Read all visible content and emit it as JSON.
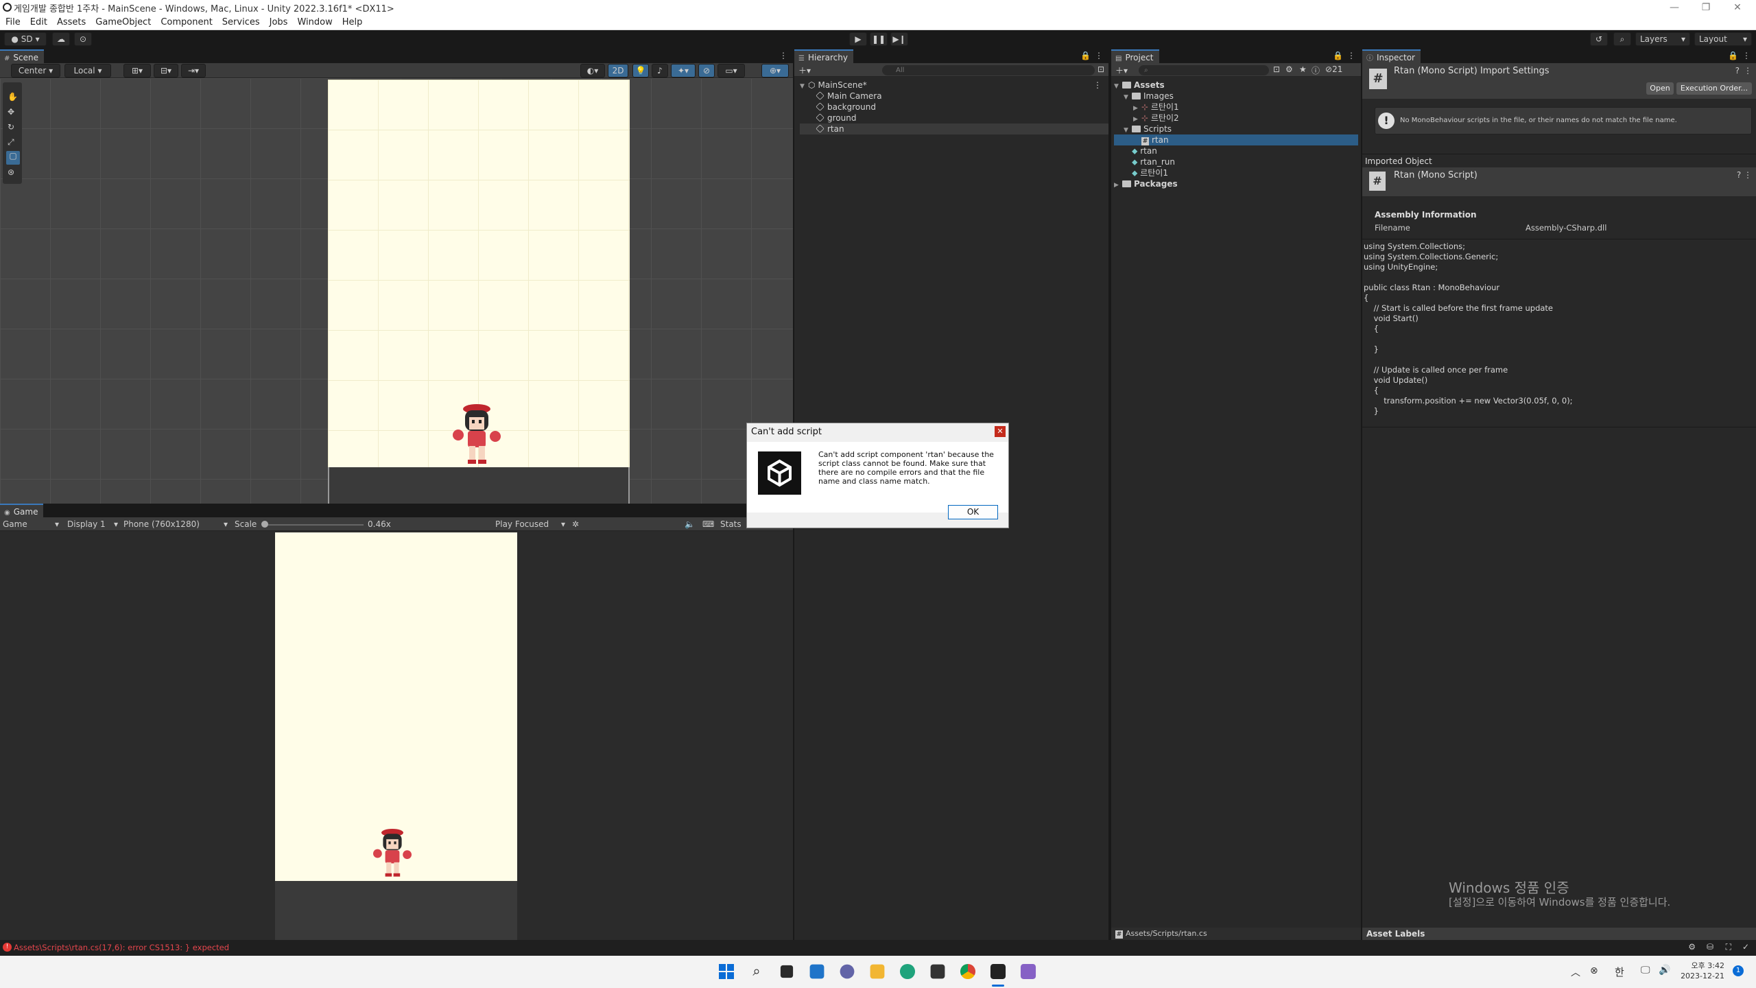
{
  "window": {
    "title": "게임개발 종합반 1주차 - MainScene - Windows, Mac, Linux - Unity 2022.3.16f1* <DX11>"
  },
  "menu": [
    "File",
    "Edit",
    "Assets",
    "GameObject",
    "Component",
    "Services",
    "Jobs",
    "Window",
    "Help"
  ],
  "toolbar": {
    "account": "SD",
    "layers": "Layers",
    "layout": "Layout"
  },
  "scene": {
    "tab": "Scene",
    "pivot": "Center",
    "space": "Local",
    "mode2d": "2D"
  },
  "game": {
    "tab": "Game",
    "view": "Game",
    "display": "Display 1",
    "resolution": "Phone (760x1280)",
    "scale_label": "Scale",
    "scale_value": "0.46x",
    "play_focus": "Play Focused",
    "stats": "Stats"
  },
  "hierarchy": {
    "tab": "Hierarchy",
    "search_placeholder": "All",
    "scene": "MainScene*",
    "items": [
      "Main Camera",
      "background",
      "ground",
      "rtan"
    ]
  },
  "project": {
    "tab": "Project",
    "count": "21",
    "root": "Assets",
    "items": [
      {
        "label": "Images",
        "depth": 1,
        "type": "folder"
      },
      {
        "label": "르탄이1",
        "depth": 2,
        "type": "sprite"
      },
      {
        "label": "르탄이2",
        "depth": 2,
        "type": "sprite"
      },
      {
        "label": "Scripts",
        "depth": 1,
        "type": "folder"
      },
      {
        "label": "rtan",
        "depth": 2,
        "type": "script"
      },
      {
        "label": "rtan",
        "depth": 1,
        "type": "anim"
      },
      {
        "label": "rtan_run",
        "depth": 1,
        "type": "anim"
      },
      {
        "label": "르탄이1",
        "depth": 1,
        "type": "anim"
      }
    ],
    "packages": "Packages",
    "footer_path": "Assets/Scripts/rtan.cs"
  },
  "inspector": {
    "tab": "Inspector",
    "title": "Rtan (Mono Script) Import Settings",
    "open": "Open",
    "execution_order": "Execution Order...",
    "warning": "No MonoBehaviour scripts in the file, or their names do not match the file name.",
    "imported_object": "Imported Object",
    "object_name": "Rtan (Mono Script)",
    "assembly_info": "Assembly Information",
    "filename_label": "Filename",
    "filename_value": "Assembly-CSharp.dll",
    "code": "using System.Collections;\nusing System.Collections.Generic;\nusing UnityEngine;\n\npublic class Rtan : MonoBehaviour\n{\n    // Start is called before the first frame update\n    void Start()\n    {\n\n    }\n\n    // Update is called once per frame\n    void Update()\n    {\n        transform.position += new Vector3(0.05f, 0, 0);\n    }",
    "asset_labels": "Asset Labels",
    "watermark_title": "Windows 정품 인증",
    "watermark_sub": "[설정]으로 이동하여 Windows를 정품 인증합니다."
  },
  "dialog": {
    "title": "Can't add script",
    "message": "Can't add script component 'rtan' because the script class cannot be found. Make sure that there are no compile errors and that the file name and class name match.",
    "ok": "OK"
  },
  "status": {
    "error": "Assets\\Scripts\\rtan.cs(17,6): error CS1513: } expected"
  },
  "taskbar": {
    "time": "오후 3:42",
    "date": "2023-12-21",
    "ime": "한",
    "notif": "1"
  }
}
